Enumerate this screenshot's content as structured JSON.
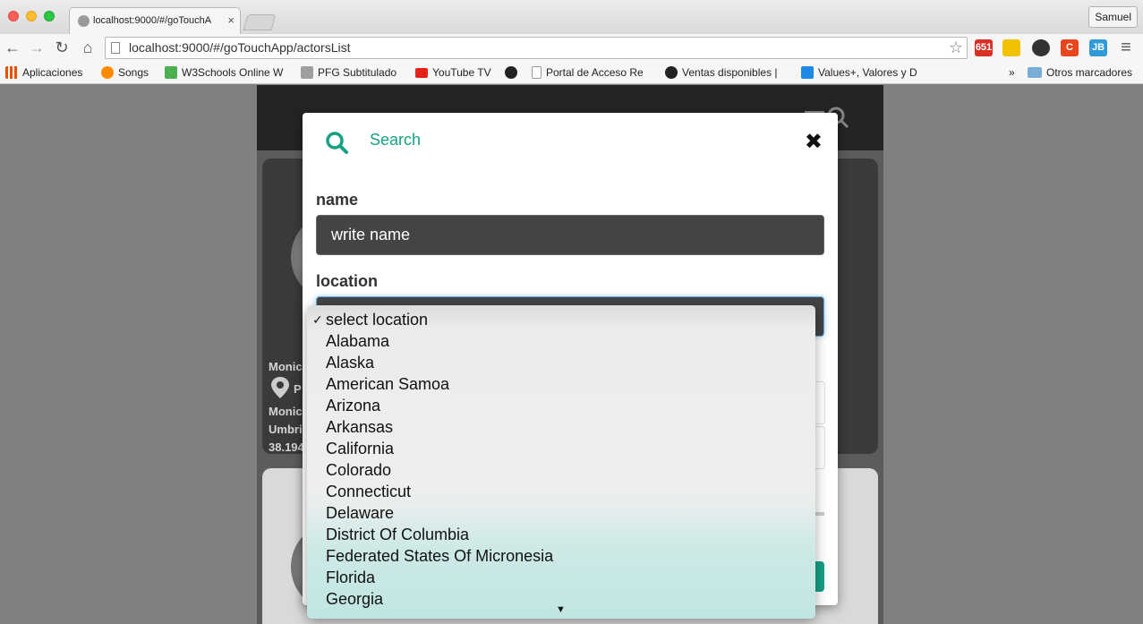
{
  "browser": {
    "tab_title": "localhost:9000/#/goTouchA",
    "tab_close": "×",
    "profile_name": "Samuel",
    "url": "localhost:9000/#/goTouchApp/actorsList",
    "extensions": [
      {
        "name": "gmail-icon",
        "badge": "651",
        "color": "#d93025"
      },
      {
        "name": "cast-icon",
        "badge": "",
        "color": "#f2c200"
      },
      {
        "name": "pocket-icon",
        "badge": "",
        "color": "#333333"
      },
      {
        "name": "c-icon",
        "badge": "C",
        "color": "#e8461c"
      },
      {
        "name": "jb-icon",
        "badge": "JB",
        "color": "#2e9bd6"
      }
    ]
  },
  "bookmarks": {
    "items": [
      {
        "label": "Aplicaciones",
        "icon": "apps-grid-icon",
        "color": "#e65100"
      },
      {
        "label": "Songs",
        "icon": "songs-icon",
        "color": "#ff8a00"
      },
      {
        "label": "W3Schools Online W",
        "icon": "w3schools-icon",
        "color": "#4caf50"
      },
      {
        "label": "PFG Subtitulado",
        "icon": "pfg-icon",
        "color": "#9e9e9e"
      },
      {
        "label": "YouTube TV",
        "icon": "youtube-icon",
        "color": "#e62117"
      },
      {
        "label": "",
        "icon": "bookmark-c-icon",
        "color": "#222222"
      },
      {
        "label": "Portal de Acceso Re",
        "icon": "page-icon",
        "color": "#bdbdbd"
      },
      {
        "label": "Ventas disponibles |",
        "icon": "ventas-icon",
        "color": "#222222"
      },
      {
        "label": "Values+, Valores y D",
        "icon": "values-icon",
        "color": "#1e88e5"
      }
    ],
    "overflow": "»",
    "other": "Otros marcadores"
  },
  "background": {
    "card1_lines": [
      "Monica",
      "P",
      "Monica",
      "Umbria",
      "38.194"
    ]
  },
  "modal": {
    "title": "Search",
    "close": "✖",
    "name_label": "name",
    "name_placeholder": "write name",
    "location_label": "location"
  },
  "dropdown": {
    "selected": "select location",
    "check": "✓",
    "scroll_arrow": "▼",
    "options": [
      "select location",
      "Alabama",
      "Alaska",
      "American Samoa",
      "Arizona",
      "Arkansas",
      "California",
      "Colorado",
      "Connecticut",
      "Delaware",
      "District Of Columbia",
      "Federated States Of Micronesia",
      "Florida",
      "Georgia"
    ]
  }
}
